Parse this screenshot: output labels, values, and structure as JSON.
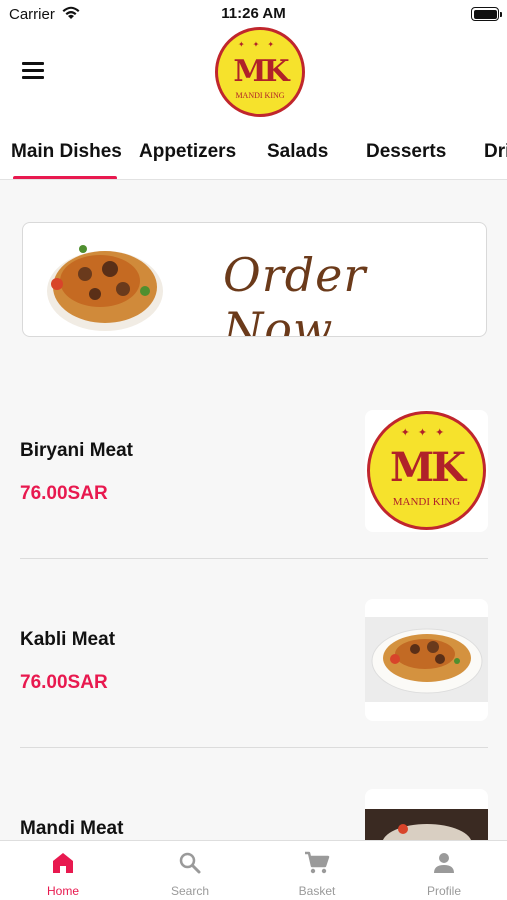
{
  "status_bar": {
    "carrier": "Carrier",
    "time": "11:26 AM",
    "wifi_icon": "wifi-icon",
    "battery_icon": "battery-icon"
  },
  "header": {
    "menu_icon": "hamburger-menu-icon",
    "logo_monogram": "MK",
    "logo_text": "MANDI KING"
  },
  "categories": [
    {
      "label": "Main Dishes",
      "active": true
    },
    {
      "label": "Appetizers"
    },
    {
      "label": "Salads"
    },
    {
      "label": "Desserts"
    },
    {
      "label": "Dri"
    }
  ],
  "banner": {
    "text": "Order Now"
  },
  "items": [
    {
      "name": "Biryani Meat",
      "price": "76.00SAR",
      "image": "mandi-king-logo"
    },
    {
      "name": "Kabli Meat",
      "price": "76.00SAR",
      "image": "rice-plate-photo"
    },
    {
      "name": "Mandi Meat",
      "price": "",
      "image": "mandi-photo"
    }
  ],
  "tab_bar": [
    {
      "label": "Home",
      "icon": "home-icon",
      "active": true
    },
    {
      "label": "Search",
      "icon": "search-icon"
    },
    {
      "label": "Basket",
      "icon": "cart-icon"
    },
    {
      "label": "Profile",
      "icon": "person-icon"
    }
  ],
  "colors": {
    "accent": "#e8194f",
    "logo_yellow": "#f6e22c",
    "logo_red": "#c0262d",
    "banner_script": "#6b3a1a"
  }
}
